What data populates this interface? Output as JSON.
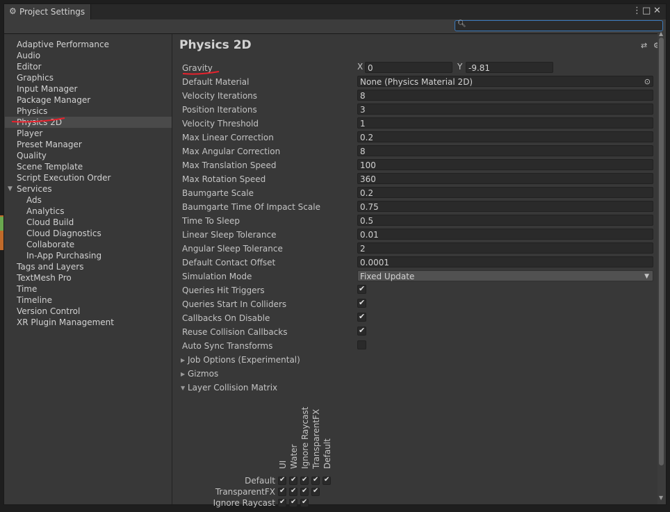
{
  "window": {
    "title": "Project Settings",
    "menu_icon": "⋮",
    "maximize_icon": "□",
    "close_icon": "✕"
  },
  "search": {
    "value": "",
    "placeholder": ""
  },
  "sidebar": {
    "items": [
      {
        "label": "Adaptive Performance",
        "indent": 0
      },
      {
        "label": "Audio",
        "indent": 0
      },
      {
        "label": "Editor",
        "indent": 0
      },
      {
        "label": "Graphics",
        "indent": 0
      },
      {
        "label": "Input Manager",
        "indent": 0
      },
      {
        "label": "Package Manager",
        "indent": 0
      },
      {
        "label": "Physics",
        "indent": 0
      },
      {
        "label": "Physics 2D",
        "indent": 0,
        "selected": true
      },
      {
        "label": "Player",
        "indent": 0
      },
      {
        "label": "Preset Manager",
        "indent": 0
      },
      {
        "label": "Quality",
        "indent": 0
      },
      {
        "label": "Scene Template",
        "indent": 0
      },
      {
        "label": "Script Execution Order",
        "indent": 0
      },
      {
        "label": "Services",
        "indent": 0,
        "expanded": true
      },
      {
        "label": "Ads",
        "indent": 1
      },
      {
        "label": "Analytics",
        "indent": 1
      },
      {
        "label": "Cloud Build",
        "indent": 1
      },
      {
        "label": "Cloud Diagnostics",
        "indent": 1
      },
      {
        "label": "Collaborate",
        "indent": 1
      },
      {
        "label": "In-App Purchasing",
        "indent": 1
      },
      {
        "label": "Tags and Layers",
        "indent": 0
      },
      {
        "label": "TextMesh Pro",
        "indent": 0
      },
      {
        "label": "Time",
        "indent": 0
      },
      {
        "label": "Timeline",
        "indent": 0
      },
      {
        "label": "Version Control",
        "indent": 0
      },
      {
        "label": "XR Plugin Management",
        "indent": 0
      }
    ]
  },
  "main": {
    "title": "Physics 2D",
    "gravity": {
      "label": "Gravity",
      "x_label": "X",
      "x": "0",
      "y_label": "Y",
      "y": "-9.81"
    },
    "default_material": {
      "label": "Default Material",
      "value": "None (Physics Material 2D)"
    },
    "fields": [
      {
        "label": "Velocity Iterations",
        "value": "8"
      },
      {
        "label": "Position Iterations",
        "value": "3"
      },
      {
        "label": "Velocity Threshold",
        "value": "1"
      },
      {
        "label": "Max Linear Correction",
        "value": "0.2"
      },
      {
        "label": "Max Angular Correction",
        "value": "8"
      },
      {
        "label": "Max Translation Speed",
        "value": "100"
      },
      {
        "label": "Max Rotation Speed",
        "value": "360"
      },
      {
        "label": "Baumgarte Scale",
        "value": "0.2"
      },
      {
        "label": "Baumgarte Time Of Impact Scale",
        "value": "0.75"
      },
      {
        "label": "Time To Sleep",
        "value": "0.5"
      },
      {
        "label": "Linear Sleep Tolerance",
        "value": "0.01"
      },
      {
        "label": "Angular Sleep Tolerance",
        "value": "2"
      },
      {
        "label": "Default Contact Offset",
        "value": "0.0001"
      }
    ],
    "simulation_mode": {
      "label": "Simulation Mode",
      "value": "Fixed Update"
    },
    "toggles": [
      {
        "label": "Queries Hit Triggers",
        "checked": true
      },
      {
        "label": "Queries Start In Colliders",
        "checked": true
      },
      {
        "label": "Callbacks On Disable",
        "checked": true
      },
      {
        "label": "Reuse Collision Callbacks",
        "checked": true
      },
      {
        "label": "Auto Sync Transforms",
        "checked": false
      }
    ],
    "foldouts": [
      {
        "label": "Job Options (Experimental)",
        "expanded": false
      },
      {
        "label": "Gizmos",
        "expanded": false
      },
      {
        "label": "Layer Collision Matrix",
        "expanded": true
      }
    ],
    "matrix": {
      "columns": [
        "UI",
        "Water",
        "Ignore Raycast",
        "TransparentFX",
        "Default"
      ],
      "rows": [
        {
          "label": "Default",
          "count": 5
        },
        {
          "label": "TransparentFX",
          "count": 4
        },
        {
          "label": "Ignore Raycast",
          "count": 3
        }
      ],
      "check": "✔"
    }
  },
  "colors": {
    "accent": "#3a79bb",
    "annotation": "#e8222d"
  }
}
